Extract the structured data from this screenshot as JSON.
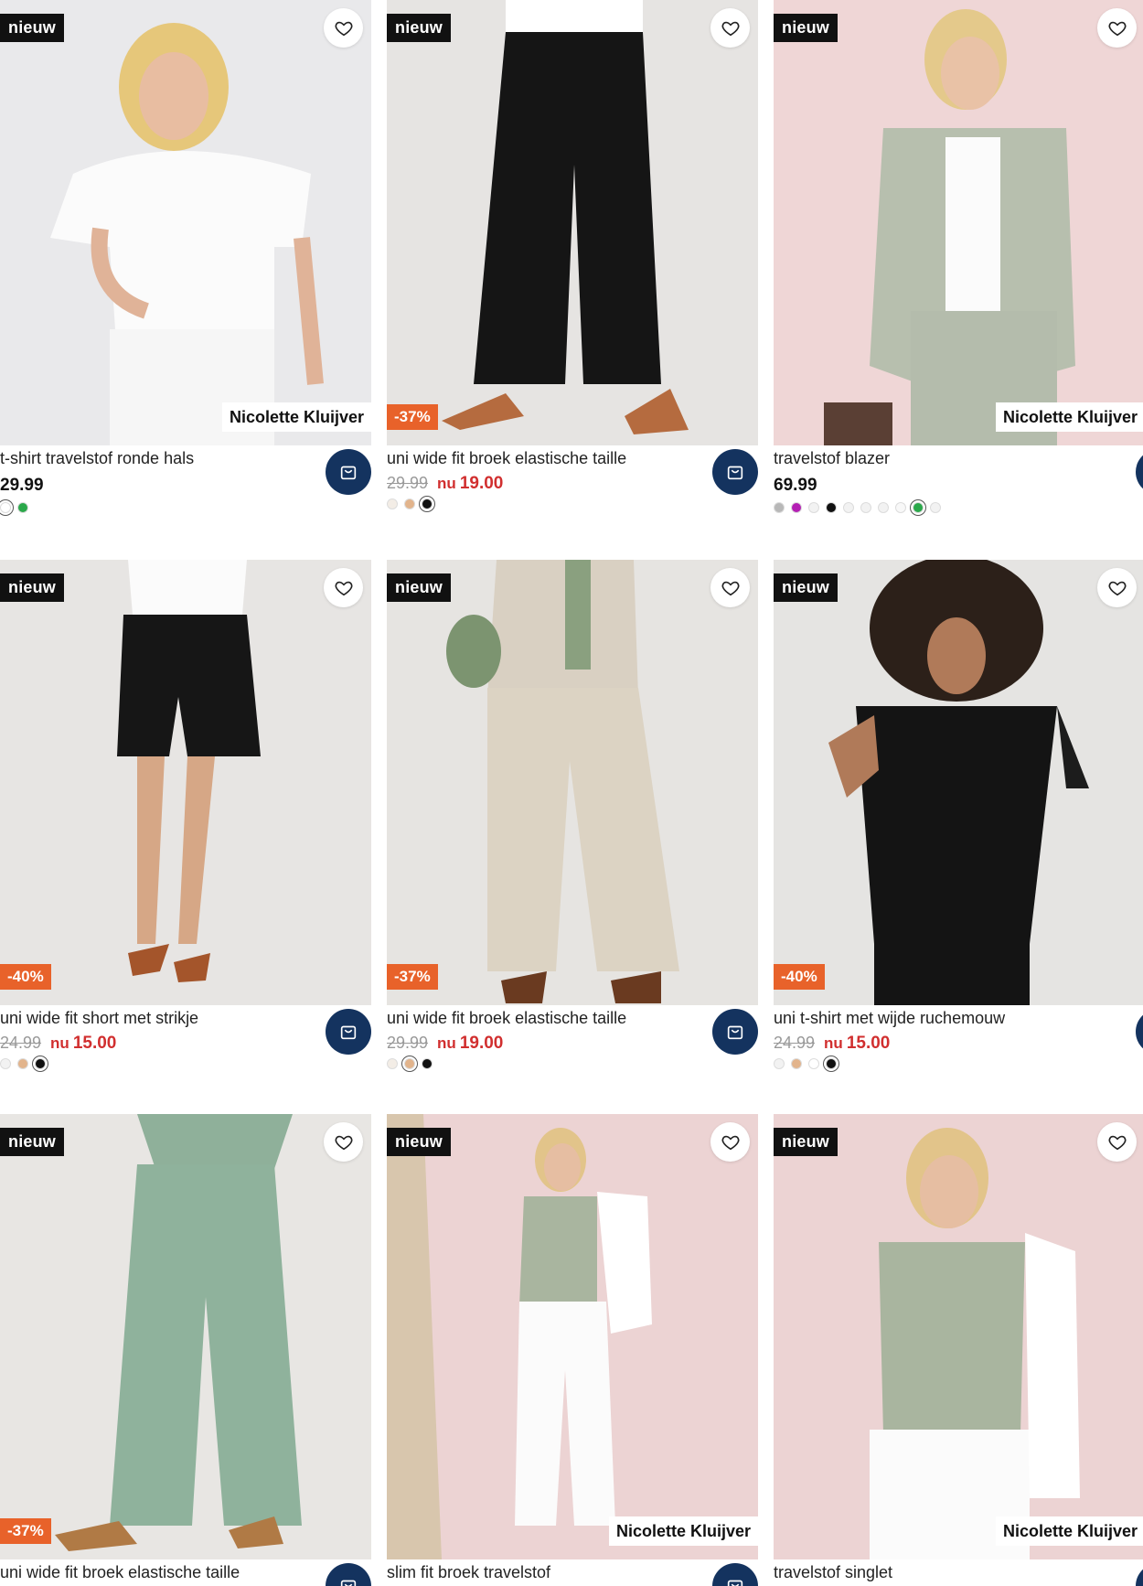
{
  "products": [
    {
      "badge_new": "nieuw",
      "brand": "Nicolette Kluijver",
      "title": "t-shirt travelstof ronde hals",
      "price": "29.99",
      "bg": "#e9e9eb",
      "swatches": [
        "#ffffff",
        "#2aa84a"
      ]
    },
    {
      "badge_new": "nieuw",
      "discount": "-37%",
      "title": "uni wide fit broek elastische taille",
      "old_price": "29.99",
      "nu_label": "nu",
      "new_price": "19.00",
      "bg": "#e6e4e2",
      "swatches": [
        "#f3ede6",
        "#e2b48c",
        "#111111"
      ]
    },
    {
      "badge_new": "nieuw",
      "brand": "Nicolette Kluijver",
      "title": "travelstof blazer",
      "price": "69.99",
      "bg": "#efd6d6",
      "swatches": [
        "#b8b8b8",
        "#b41fb4",
        "#f2f2f2",
        "#111111",
        "#f2f2f2",
        "#f2f2f2",
        "#f2f2f2",
        "#f8f8f8",
        "#2aa84a",
        "#f2f2f2"
      ]
    },
    {
      "badge_new": "nieuw",
      "discount": "-40%",
      "title": "uni wide fit short met strikje",
      "old_price": "24.99",
      "nu_label": "nu",
      "new_price": "15.00",
      "bg": "#e7e5e3",
      "swatches": [
        "#f2f2f2",
        "#e2b48c",
        "#111111"
      ]
    },
    {
      "badge_new": "nieuw",
      "discount": "-37%",
      "title": "uni wide fit broek elastische taille",
      "old_price": "29.99",
      "nu_label": "nu",
      "new_price": "19.00",
      "bg": "#e6e4e1",
      "swatches": [
        "#f3ede6",
        "#e2b48c",
        "#111111"
      ]
    },
    {
      "badge_new": "nieuw",
      "discount": "-40%",
      "title": "uni t-shirt met wijde ruchemouw",
      "old_price": "24.99",
      "nu_label": "nu",
      "new_price": "15.00",
      "bg": "#e5e4e2",
      "swatches": [
        "#f2f2f2",
        "#e2b48c",
        "#ffffff",
        "#111111"
      ]
    },
    {
      "badge_new": "nieuw",
      "discount": "-37%",
      "title": "uni wide fit broek elastische taille",
      "bg": "#e8e6e3"
    },
    {
      "badge_new": "nieuw",
      "brand": "Nicolette Kluijver",
      "title": "slim fit broek travelstof",
      "bg": "#ecd3d3"
    },
    {
      "badge_new": "nieuw",
      "brand": "Nicolette Kluijver",
      "title": "travelstof singlet",
      "bg": "#ecd3d3"
    }
  ],
  "icons": {
    "favorite": "heart-icon",
    "cart": "shopping-bag-icon"
  },
  "colors": {
    "cart_button": "#14335f",
    "discount_badge": "#e8622a",
    "sale_price": "#d12f2f"
  }
}
